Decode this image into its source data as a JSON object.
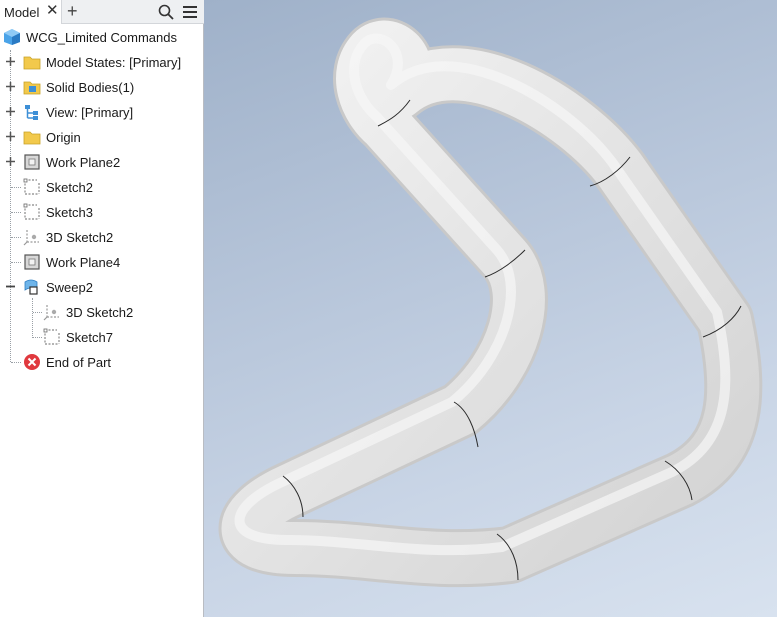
{
  "browser": {
    "tab_label": "Model",
    "tab_close_glyph": "✕",
    "tab_add_glyph": "+",
    "icons": {
      "search": "search-icon",
      "menu": "hamburger-menu-icon"
    },
    "root": {
      "label": "WCG_Limited Commands",
      "icon": "part-icon"
    },
    "items": [
      {
        "label": "Model States: [Primary]",
        "icon": "folder-icon",
        "expander": "plus"
      },
      {
        "label": "Solid Bodies(1)",
        "icon": "solid-bodies-folder-icon",
        "expander": "plus"
      },
      {
        "label": "View: [Primary]",
        "icon": "view-icon",
        "expander": "plus"
      },
      {
        "label": "Origin",
        "icon": "folder-icon",
        "expander": "plus"
      },
      {
        "label": "Work Plane2",
        "icon": "work-plane-icon",
        "expander": "plus"
      },
      {
        "label": "Sketch2",
        "icon": "sketch-icon",
        "expander": "none"
      },
      {
        "label": "Sketch3",
        "icon": "sketch-icon",
        "expander": "none"
      },
      {
        "label": "3D Sketch2",
        "icon": "3d-sketch-icon",
        "expander": "none"
      },
      {
        "label": "Work Plane4",
        "icon": "work-plane-icon",
        "expander": "none"
      },
      {
        "label": "Sweep2",
        "icon": "sweep-icon",
        "expander": "minus",
        "children": [
          {
            "label": "3D Sketch2",
            "icon": "3d-sketch-icon"
          },
          {
            "label": "Sketch7",
            "icon": "sketch-icon"
          }
        ]
      },
      {
        "label": "End of Part",
        "icon": "end-of-part-icon",
        "expander": "none"
      }
    ]
  },
  "colors": {
    "tube": "#e6e6e6",
    "folder": "#f2c94c",
    "part_blue": "#3d8fd6",
    "end_red": "#e0393e"
  }
}
